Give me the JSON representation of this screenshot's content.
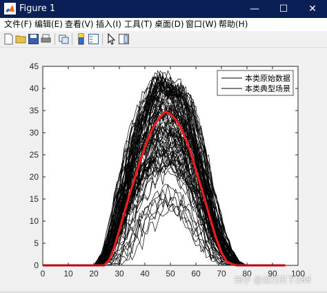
{
  "window": {
    "title": "Figure 1",
    "controls": {
      "minimize": "—",
      "maximize": "☐",
      "close": "✕"
    }
  },
  "menu": [
    "文件(F)",
    "编辑(E)",
    "查看(V)",
    "插入(I)",
    "工具(T)",
    "桌面(D)",
    "窗口(W)",
    "帮助(H)"
  ],
  "toolbar": {
    "icons": [
      "new-figure-icon",
      "open-file-icon",
      "save-icon",
      "print-icon",
      "link-icon",
      "insert-colorbar-icon",
      "insert-legend-icon",
      "pointer-icon",
      "plot-tools-icon"
    ]
  },
  "watermark": "知乎 @龙行天下288",
  "chart_data": {
    "type": "line",
    "title": "",
    "xlabel": "",
    "ylabel": "",
    "xlim": [
      0,
      100
    ],
    "ylim": [
      0,
      45
    ],
    "xticks": [
      "0",
      "10",
      "20",
      "30",
      "40",
      "50",
      "60",
      "70",
      "80",
      "90",
      "100"
    ],
    "yticks": [
      "0",
      "5",
      "10",
      "15",
      "20",
      "25",
      "30",
      "35",
      "40",
      "45"
    ],
    "grid": false,
    "legend": {
      "position": "top-right",
      "entries": [
        "本类原始数据",
        "本类典型场景"
      ]
    },
    "series": [
      {
        "name": "本类原始数据",
        "color": "#000000",
        "count_estimate": 100,
        "description_envelope": {
          "x": [
            22,
            25,
            28,
            30,
            33,
            36,
            39,
            42,
            45,
            48,
            51,
            54,
            57,
            60,
            63,
            66,
            69,
            72,
            75,
            78
          ],
          "upper": [
            0,
            3,
            10,
            17,
            24,
            31,
            36,
            40,
            44,
            42,
            41,
            40,
            37,
            31,
            24,
            16,
            9,
            4,
            1,
            0
          ],
          "lower": [
            0,
            0,
            0,
            0,
            2,
            4,
            7,
            9,
            10,
            12,
            12,
            10,
            8,
            5,
            3,
            1,
            0,
            0,
            0,
            0
          ]
        }
      },
      {
        "name": "本类典型场景",
        "color": "#ee1c1c",
        "x": [
          0,
          5,
          10,
          15,
          20,
          24,
          26,
          28,
          30,
          32,
          34,
          36,
          38,
          40,
          42,
          44,
          46,
          48,
          50,
          52,
          54,
          56,
          58,
          60,
          62,
          64,
          66,
          68,
          70,
          72,
          74,
          76,
          80,
          85,
          90,
          95
        ],
        "y": [
          0,
          0,
          0,
          0,
          0,
          0,
          1.2,
          4.0,
          8.0,
          12.0,
          16.0,
          19.7,
          23.3,
          26.7,
          29.7,
          32.0,
          33.5,
          34.8,
          34.2,
          33.0,
          31.2,
          28.5,
          25.5,
          21.5,
          17.8,
          13.8,
          9.8,
          6.0,
          2.9,
          0.9,
          0.3,
          0,
          0,
          0,
          0,
          0
        ]
      }
    ]
  }
}
